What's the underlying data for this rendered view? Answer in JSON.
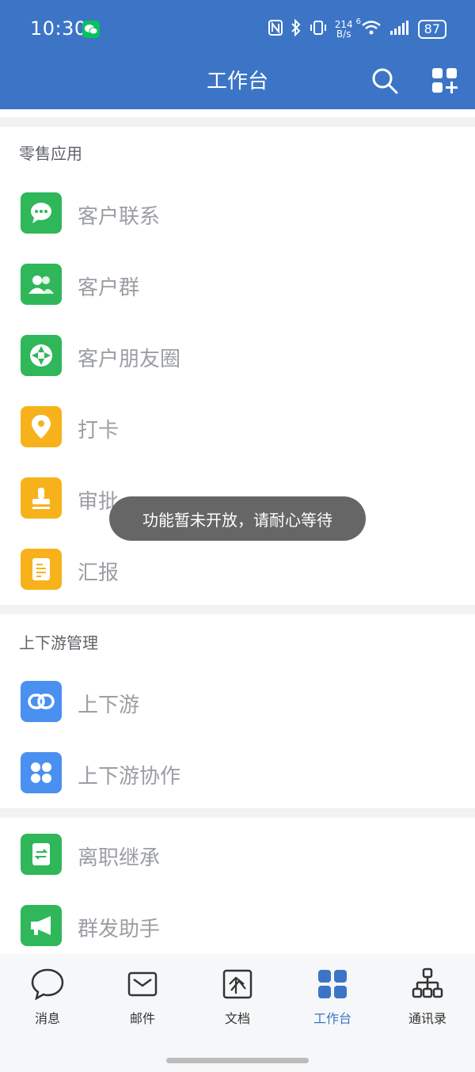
{
  "status_bar": {
    "time": "10:30",
    "net_speed_value": "214",
    "net_speed_unit": "B/s",
    "battery": "87",
    "network": "6"
  },
  "header": {
    "title": "工作台",
    "icons": [
      "search-icon",
      "add-app-icon"
    ]
  },
  "sections": [
    {
      "title": "零售应用",
      "items": [
        {
          "label": "客户联系",
          "icon": "chat-bubble-icon",
          "color": "#2fb75a"
        },
        {
          "label": "客户群",
          "icon": "customer-group-icon",
          "color": "#2fb75a"
        },
        {
          "label": "客户朋友圈",
          "icon": "moments-icon",
          "color": "#2fb75a"
        },
        {
          "label": "打卡",
          "icon": "location-pin-icon",
          "color": "#f7b21b"
        },
        {
          "label": "审批",
          "icon": "stamp-icon",
          "color": "#f7b21b"
        },
        {
          "label": "汇报",
          "icon": "report-doc-icon",
          "color": "#f7b21b"
        }
      ]
    },
    {
      "title": "上下游管理",
      "items": [
        {
          "label": "上下游",
          "icon": "link-icon",
          "color": "#4a90f0"
        },
        {
          "label": "上下游协作",
          "icon": "four-petal-icon",
          "color": "#4a90f0"
        }
      ]
    },
    {
      "title": "",
      "items": [
        {
          "label": "离职继承",
          "icon": "transfer-doc-icon",
          "color": "#2fb75a"
        },
        {
          "label": "群发助手",
          "icon": "megaphone-icon",
          "color": "#2fb75a"
        }
      ]
    }
  ],
  "toast": {
    "text": "功能暂未开放，请耐心等待"
  },
  "bottom_nav": {
    "active": "工作台",
    "active_color": "#3c75c6",
    "tabs": [
      {
        "label": "消息",
        "icon": "message-icon"
      },
      {
        "label": "邮件",
        "icon": "mail-icon"
      },
      {
        "label": "文档",
        "icon": "document-icon"
      },
      {
        "label": "工作台",
        "icon": "workbench-icon"
      },
      {
        "label": "通讯录",
        "icon": "contacts-icon"
      }
    ]
  }
}
